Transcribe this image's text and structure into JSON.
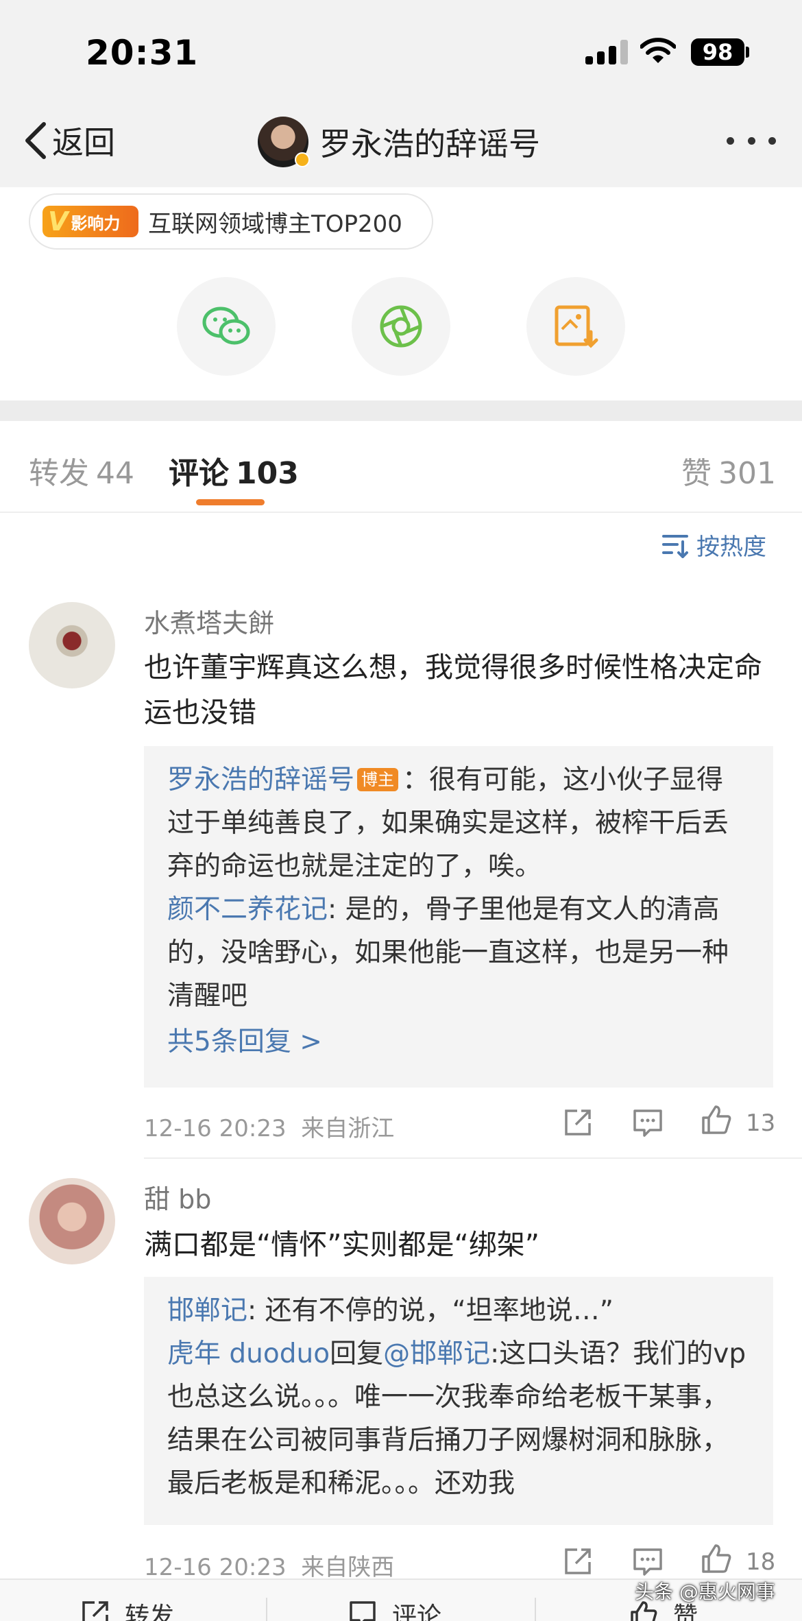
{
  "status_bar": {
    "time": "20:31",
    "battery": "98"
  },
  "nav": {
    "back_label": "返回",
    "title": "罗永浩的辞谣号"
  },
  "badge": {
    "logo_text": "影响力",
    "logo_letter": "V",
    "text": "互联网领域博主TOP200"
  },
  "share": {
    "icons": [
      "wechat-icon",
      "moments-icon",
      "save-image-icon"
    ]
  },
  "tabs": {
    "repost": {
      "label": "转发",
      "count": "44"
    },
    "comment": {
      "label": "评论",
      "count": "103"
    },
    "like": {
      "label": "赞",
      "count": "301"
    }
  },
  "sort_label": "按热度",
  "comments": [
    {
      "name": "水煮塔夫餅",
      "text": "也许董宇辉真这么想，我觉得很多时候性格决定命运也没错",
      "replies": [
        {
          "who": "罗永浩的辞谣号",
          "tag": "博主",
          "text": "：很有可能，这小伙子显得过于单纯善良了，如果确实是这样，被榨干后丢弃的命运也就是注定的了，唉。"
        },
        {
          "who": "颜不二养花记",
          "text": ": 是的，骨子里他是有文人的清高的，没啥野心，如果他能一直这样，也是另一种清醒吧"
        }
      ],
      "more_replies": "共5条回复 >",
      "time": "12-16 20:23",
      "location": "来自浙江",
      "likes": "13"
    },
    {
      "name": "甜 bb",
      "text": "满口都是“情怀”实则都是“绑架”",
      "replies": [
        {
          "who": "邯郸记",
          "text": ": 还有不停的说，“坦率地说…”"
        },
        {
          "who": "虎年 duoduo",
          "mid": "回复",
          "who2": "@邯郸记",
          "text": ":这口头语？我们的vp也总这么说。。。唯一一次我奉命给老板干某事，结果在公司被同事背后捅刀子网爆树洞和脉脉，最后老板是和稀泥。。。还劝我"
        }
      ],
      "time": "12-16 20:23",
      "location": "来自陕西",
      "likes": "18"
    }
  ],
  "bottom_bar": {
    "repost": "转发",
    "comment": "评论",
    "like": "赞"
  },
  "watermark": "头条 @惠火网事"
}
